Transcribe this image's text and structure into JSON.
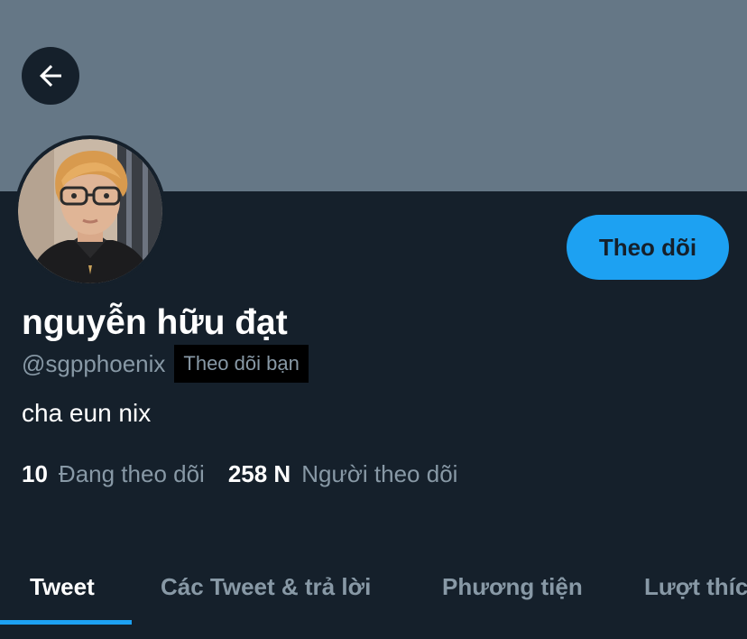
{
  "header": {
    "back_icon": "arrow-left-icon"
  },
  "profile": {
    "display_name": "nguyễn hữu đạt",
    "handle": "@sgpphoenix",
    "follows_you_badge": "Theo dõi bạn",
    "bio": "cha eun nix",
    "follow_button_label": "Theo dõi",
    "avatar_alt": "avatar"
  },
  "stats": {
    "following_count": "10",
    "following_label": "Đang theo dõi",
    "followers_count": "258 N",
    "followers_label": "Người theo dõi"
  },
  "tabs": [
    {
      "label": "Tweet",
      "active": true
    },
    {
      "label": "Các Tweet & trả lời",
      "active": false
    },
    {
      "label": "Phương tiện",
      "active": false
    },
    {
      "label": "Lượt thích",
      "active": false
    }
  ],
  "colors": {
    "background": "#15202b",
    "banner": "#657786",
    "accent": "#1da1f2",
    "secondary_text": "#8899a6",
    "primary_text": "#ffffff"
  }
}
